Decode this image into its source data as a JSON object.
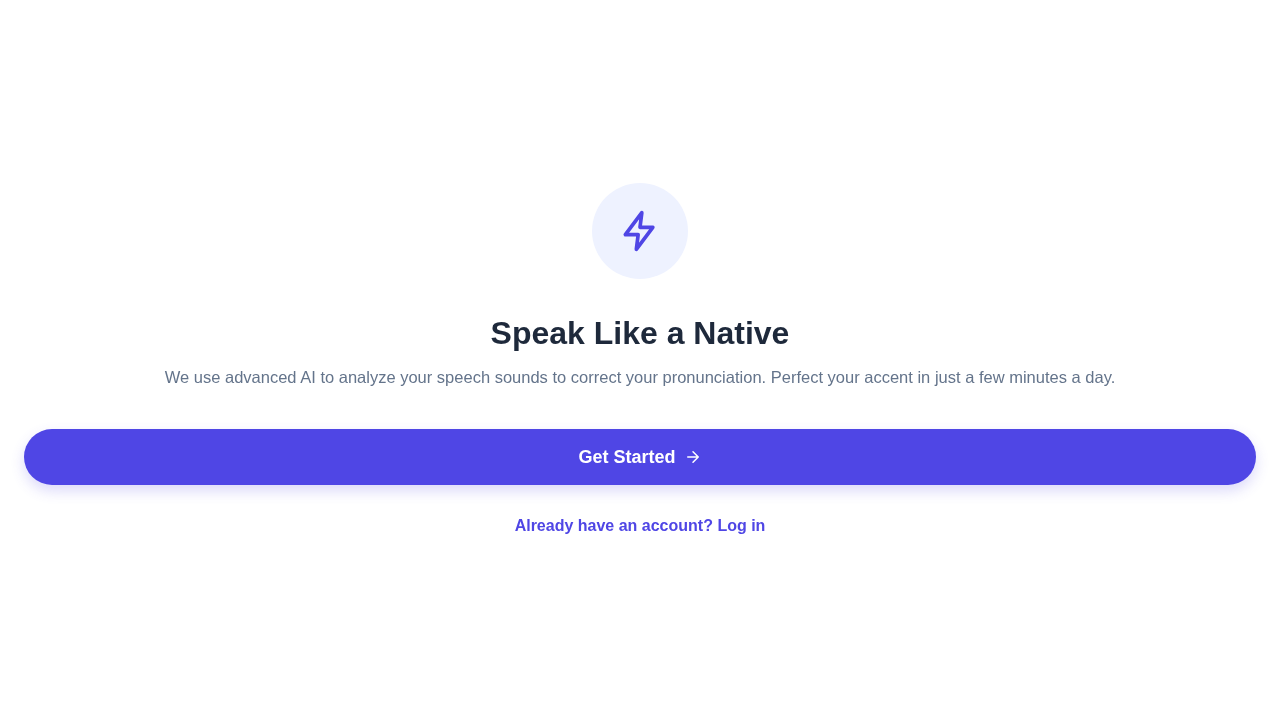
{
  "hero": {
    "title": "Speak Like a Native",
    "description": "We use advanced AI to analyze your speech sounds to correct your pronunciation. Perfect your accent in just a few minutes a day."
  },
  "primary_button": {
    "label": "Get Started"
  },
  "login_link": {
    "label": "Already have an account? Log in"
  }
}
